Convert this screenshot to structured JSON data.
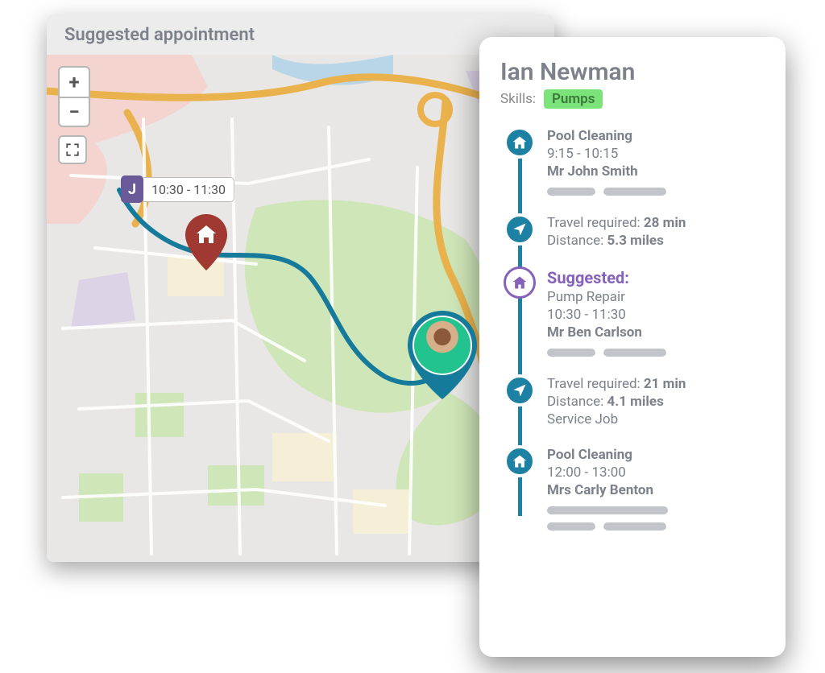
{
  "map": {
    "title": "Suggested appointment",
    "badge": {
      "letter": "J",
      "time": "10:30 - 11:30"
    }
  },
  "side": {
    "name": "Ian Newman",
    "skills_label": "Skills:",
    "skills": [
      "Pumps"
    ],
    "timeline": [
      {
        "kind": "job",
        "icon": "house",
        "title": "Pool Cleaning",
        "time": "9:15 - 10:15",
        "customer": "Mr John Smith"
      },
      {
        "kind": "travel",
        "icon": "nav",
        "label": "Travel required:",
        "duration": "28 min",
        "dist_label": "Distance:",
        "distance": "5.3 miles"
      },
      {
        "kind": "suggested",
        "icon": "house",
        "suggested_label": "Suggested:",
        "title": "Pump Repair",
        "time": "10:30 - 11:30",
        "customer": "Mr Ben Carlson"
      },
      {
        "kind": "travel",
        "icon": "nav",
        "label": "Travel required:",
        "duration": "21 min",
        "dist_label": "Distance:",
        "distance": "4.1 miles",
        "note": "Service Job"
      },
      {
        "kind": "job",
        "icon": "house",
        "title": "Pool Cleaning",
        "time": "12:00 - 13:00",
        "customer": "Mrs Carly Benton"
      }
    ]
  }
}
